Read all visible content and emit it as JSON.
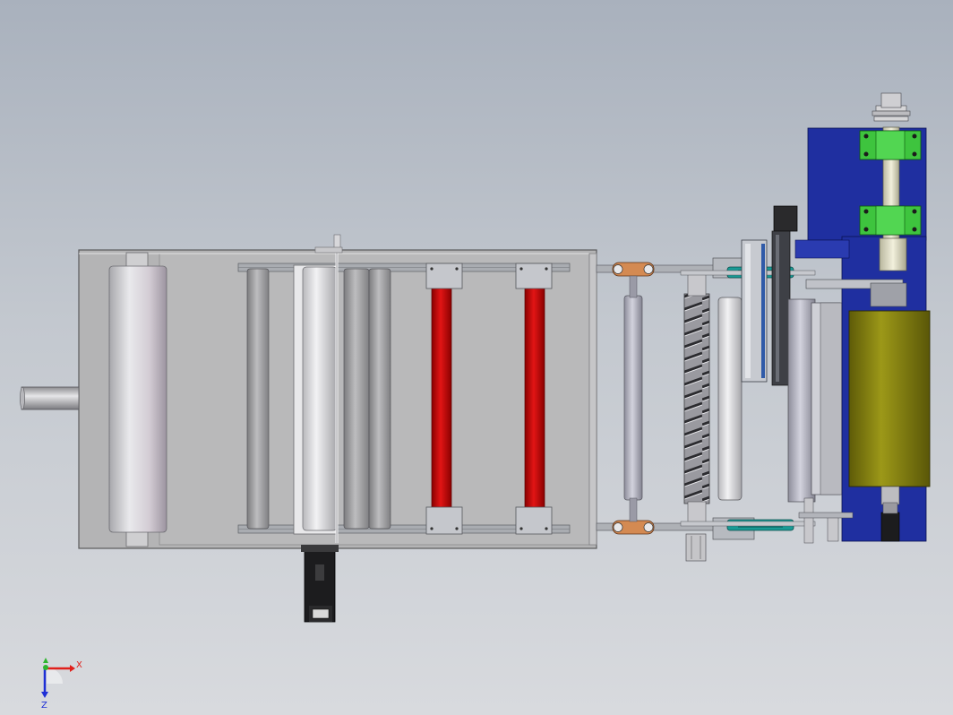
{
  "viewport": {
    "background_top": "#a9b1bd",
    "background_bottom": "#d8dade"
  },
  "triad": {
    "x_label": "X",
    "z_label": "Z",
    "x_color": "#e0201b",
    "y_color": "#2fb52f",
    "z_color": "#1e2fd6"
  },
  "colors": {
    "frame": "#b6b6b6",
    "rail": "#a8abb0",
    "red_roller": "#d20a0a",
    "blue_plate": "#1f2fa0",
    "green_block": "#3ec43e",
    "olive_drum": "#7d7a12",
    "copper_clip": "#d48a52",
    "teal_bracket": "#1a9a95",
    "motor": "#1c1c1c"
  },
  "icons": {
    "orientation_triad": "xyz-axis-triad-icon"
  }
}
